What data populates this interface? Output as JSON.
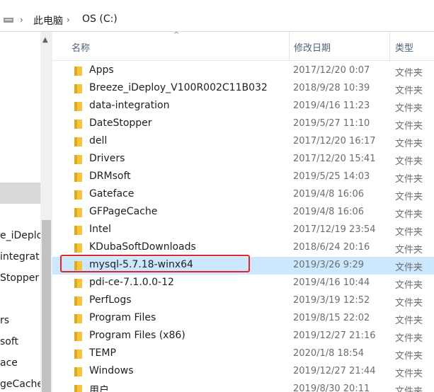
{
  "address": {
    "crumbs": [
      "此电脑",
      "OS (C:)"
    ],
    "separator": "›"
  },
  "nav": {
    "items": [
      "",
      "",
      "",
      "",
      "",
      "",
      "",
      "",
      "e_iDeplo",
      "integrati",
      "Stopper",
      "",
      "rs",
      "soft",
      "ace",
      "geCache"
    ]
  },
  "columns": {
    "name": "名称",
    "date": "修改日期",
    "type": "类型"
  },
  "files": [
    {
      "name": "Apps",
      "date": "2017/12/20 0:07",
      "type": "文件夹"
    },
    {
      "name": "Breeze_iDeploy_V100R002C11B032",
      "date": "2018/9/28 10:39",
      "type": "文件夹"
    },
    {
      "name": "data-integration",
      "date": "2019/4/16 11:23",
      "type": "文件夹"
    },
    {
      "name": "DateStopper",
      "date": "2019/5/27 11:10",
      "type": "文件夹"
    },
    {
      "name": "dell",
      "date": "2017/12/20 16:17",
      "type": "文件夹"
    },
    {
      "name": "Drivers",
      "date": "2017/12/20 15:41",
      "type": "文件夹"
    },
    {
      "name": "DRMsoft",
      "date": "2019/5/25 14:03",
      "type": "文件夹"
    },
    {
      "name": "Gateface",
      "date": "2019/4/8 16:06",
      "type": "文件夹"
    },
    {
      "name": "GFPageCache",
      "date": "2019/4/8 16:06",
      "type": "文件夹"
    },
    {
      "name": "Intel",
      "date": "2017/12/19 23:54",
      "type": "文件夹"
    },
    {
      "name": "KDubaSoftDownloads",
      "date": "2018/6/24 20:16",
      "type": "文件夹"
    },
    {
      "name": "mysql-5.7.18-winx64",
      "date": "2019/3/26 9:29",
      "type": "文件夹",
      "selected": true
    },
    {
      "name": "pdi-ce-7.1.0.0-12",
      "date": "2019/4/16 10:44",
      "type": "文件夹"
    },
    {
      "name": "PerfLogs",
      "date": "2019/3/19 12:52",
      "type": "文件夹"
    },
    {
      "name": "Program Files",
      "date": "2019/8/15 22:02",
      "type": "文件夹"
    },
    {
      "name": "Program Files (x86)",
      "date": "2019/12/27 21:16",
      "type": "文件夹"
    },
    {
      "name": "TEMP",
      "date": "2020/1/8 18:54",
      "type": "文件夹"
    },
    {
      "name": "Windows",
      "date": "2019/12/27 21:44",
      "type": "文件夹"
    },
    {
      "name": "用户",
      "date": "2019/8/30 20:11",
      "type": "文件夹"
    }
  ],
  "colors": {
    "selected_row": "#cce8ff",
    "highlight_border": "#e0252b",
    "folder": "#f5c542"
  },
  "icons": {
    "folder": "folder-icon",
    "drive": "drive-icon",
    "sort": "sort-up-icon"
  }
}
